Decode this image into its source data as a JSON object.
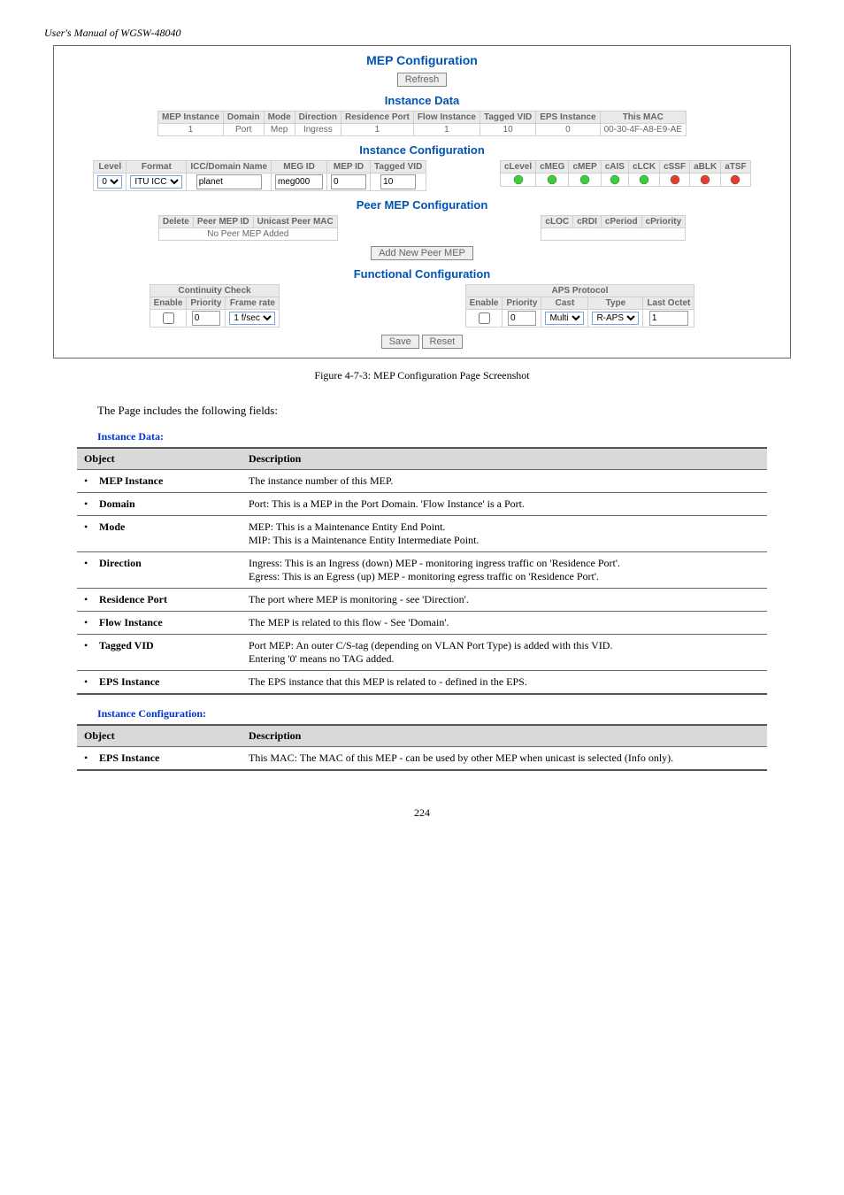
{
  "manual_title": "User's Manual of WGSW-48040",
  "figure": {
    "title": "MEP Configuration",
    "refresh_btn": "Refresh",
    "instance_data": {
      "heading": "Instance Data",
      "headers": [
        "MEP Instance",
        "Domain",
        "Mode",
        "Direction",
        "Residence Port",
        "Flow Instance",
        "Tagged VID",
        "EPS Instance",
        "This MAC"
      ],
      "row": [
        "1",
        "Port",
        "Mep",
        "Ingress",
        "1",
        "1",
        "10",
        "0",
        "00-30-4F-A8-E9-AE"
      ]
    },
    "instance_cfg": {
      "heading": "Instance Configuration",
      "left_headers": [
        "Level",
        "Format",
        "ICC/Domain Name",
        "MEG ID",
        "MEP ID",
        "Tagged VID"
      ],
      "left_vals": {
        "level": "0",
        "format": "ITU ICC",
        "icc": "planet",
        "meg": "meg000",
        "mepid": "0",
        "vid": "10"
      },
      "right_headers": [
        "cLevel",
        "cMEG",
        "cMEP",
        "cAIS",
        "cLCK",
        "cSSF",
        "aBLK",
        "aTSF"
      ],
      "right_colors": [
        "#3bcf3b",
        "#3bcf3b",
        "#3bcf3b",
        "#3bcf3b",
        "#3bcf3b",
        "#e43c2e",
        "#e43c2e",
        "#e43c2e"
      ]
    },
    "peer": {
      "heading": "Peer MEP Configuration",
      "left_headers": [
        "Delete",
        "Peer MEP ID",
        "Unicast Peer MAC"
      ],
      "empty_msg": "No Peer MEP Added",
      "right_headers": [
        "cLOC",
        "cRDI",
        "cPeriod",
        "cPriority"
      ],
      "add_btn": "Add New Peer MEP"
    },
    "func": {
      "heading": "Functional Configuration",
      "cc_title": "Continuity Check",
      "cc_headers": [
        "Enable",
        "Priority",
        "Frame rate"
      ],
      "cc_vals": {
        "prio": "0",
        "rate": "1 f/sec"
      },
      "aps_title": "APS Protocol",
      "aps_headers": [
        "Enable",
        "Priority",
        "Cast",
        "Type",
        "Last Octet"
      ],
      "aps_vals": {
        "prio": "0",
        "cast": "Multi",
        "type": "R-APS",
        "last": "1"
      }
    },
    "save_btn": "Save",
    "reset_btn": "Reset"
  },
  "caption": "Figure 4-7-3: MEP Configuration Page Screenshot",
  "intro": "The Page includes the following fields:",
  "tables": {
    "instance_data": {
      "title": "Instance Data:",
      "hdr_obj": "Object",
      "hdr_desc": "Description",
      "rows": [
        {
          "o": "MEP Instance",
          "d": "The instance number of this MEP."
        },
        {
          "o": "Domain",
          "d": "Port: This is a MEP in the Port Domain. 'Flow Instance' is a Port."
        },
        {
          "o": "Mode",
          "d": "MEP: This is a Maintenance Entity End Point.\nMIP: This is a Maintenance Entity Intermediate Point."
        },
        {
          "o": "Direction",
          "d": "Ingress: This is an Ingress (down) MEP - monitoring ingress traffic on 'Residence Port'.\nEgress: This is an Egress (up) MEP - monitoring egress traffic on 'Residence Port'."
        },
        {
          "o": "Residence Port",
          "d": "The port where MEP is monitoring - see 'Direction'."
        },
        {
          "o": "Flow Instance",
          "d": "The MEP is related to this flow - See 'Domain'."
        },
        {
          "o": "Tagged VID",
          "d": "Port MEP: An outer C/S-tag (depending on VLAN Port Type) is added with this VID.\nEntering '0' means no TAG added."
        },
        {
          "o": "EPS Instance",
          "d": "The EPS instance that this MEP is related to - defined in the EPS."
        }
      ]
    },
    "instance_cfg": {
      "title": "Instance Configuration:",
      "hdr_obj": "Object",
      "hdr_desc": "Description",
      "rows": [
        {
          "o": "EPS Instance",
          "d": "This MAC: The MAC of this MEP - can be used by other MEP when unicast is selected (Info only)."
        }
      ]
    }
  },
  "page_number": "224"
}
